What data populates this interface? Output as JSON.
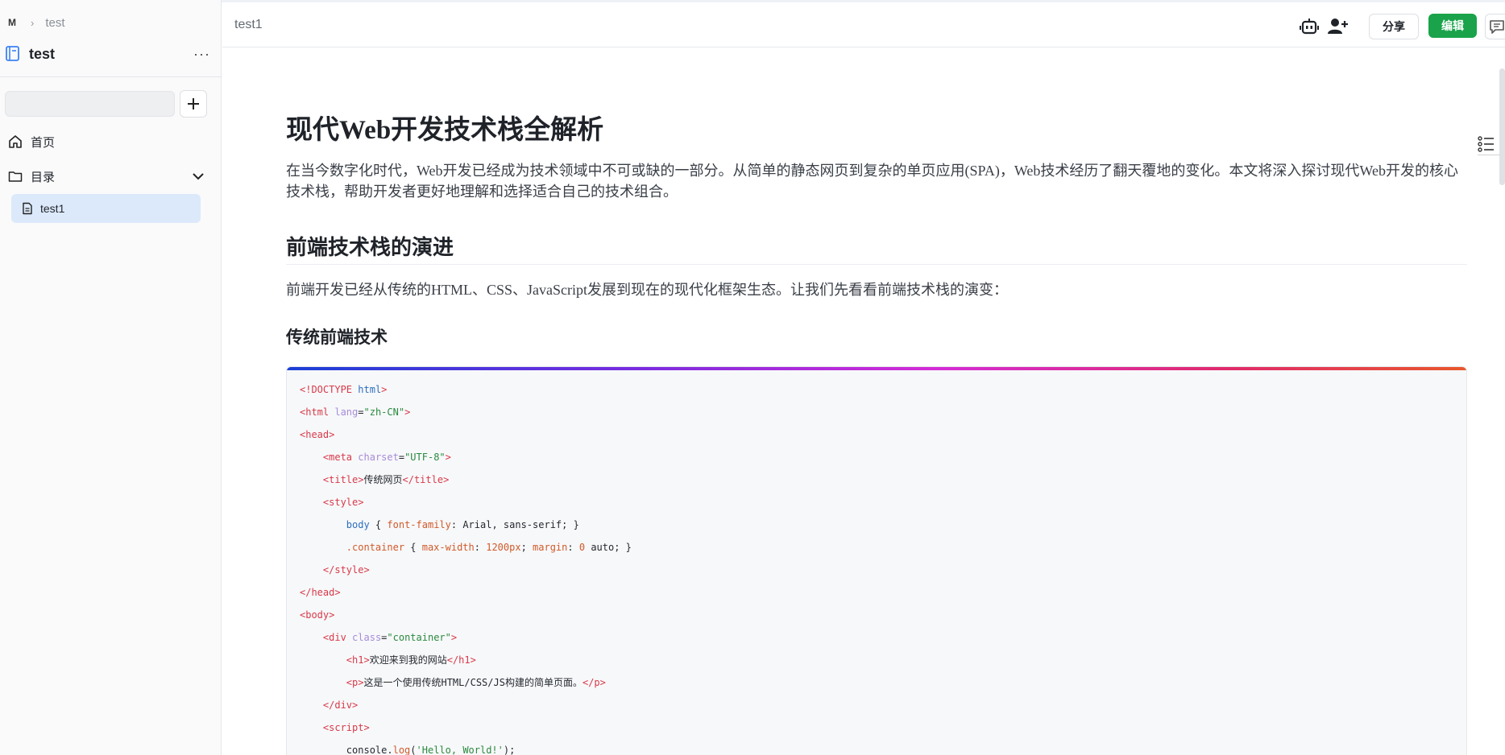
{
  "breadcrumb": {
    "logo": "M",
    "space": "test"
  },
  "sidebar": {
    "space_title": "test",
    "more_label": "···",
    "search": {
      "value": "",
      "placeholder": ""
    },
    "nav": {
      "home": "首页",
      "catalog": "目录"
    },
    "docs": [
      "test1"
    ]
  },
  "header": {
    "doc_title": "test1",
    "share_label": "分享",
    "edit_label": "编辑",
    "icons": [
      "robot-icon",
      "add-user-icon",
      "comment-icon"
    ]
  },
  "article": {
    "title": "现代Web开发技术栈全解析",
    "intro": "在当今数字化时代，Web开发已经成为技术领域中不可或缺的一部分。从简单的静态网页到复杂的单页应用(SPA)，Web技术经历了翻天覆地的变化。本文将深入探讨现代Web开发的核心技术栈，帮助开发者更好地理解和选择适合自己的技术组合。",
    "h2": "前端技术栈的演进",
    "para2": "前端开发已经从传统的HTML、CSS、JavaScript发展到现在的现代化框架生态。让我们先看看前端技术栈的演变：",
    "h3": "传统前端技术"
  },
  "code": {
    "doctype": "<!DOCTYPE",
    "doctype_name": "html",
    "html_lang_value": "\"zh-CN\"",
    "charset_value": "\"UTF-8\"",
    "title_text": "传统网页",
    "body_selector": "body",
    "font_family_prop": "font-family",
    "font_family_value": "Arial, sans-serif;",
    "container_selector": ".container",
    "max_width_prop": "max-width",
    "max_width_value": "1200px",
    "margin_prop": "margin",
    "margin_value": "0",
    "margin_rest": "auto;",
    "div_class_value": "\"container\"",
    "h1_text": "欢迎来到我的网站",
    "p_text": "这是一个使用传统HTML/CSS/JS构建的简单页面。",
    "console_obj": "console.",
    "console_fn": "log",
    "console_arg": "'Hello, World!'"
  },
  "colors": {
    "accent_green": "#1aa34a",
    "selected_bg": "#dce9fa"
  }
}
